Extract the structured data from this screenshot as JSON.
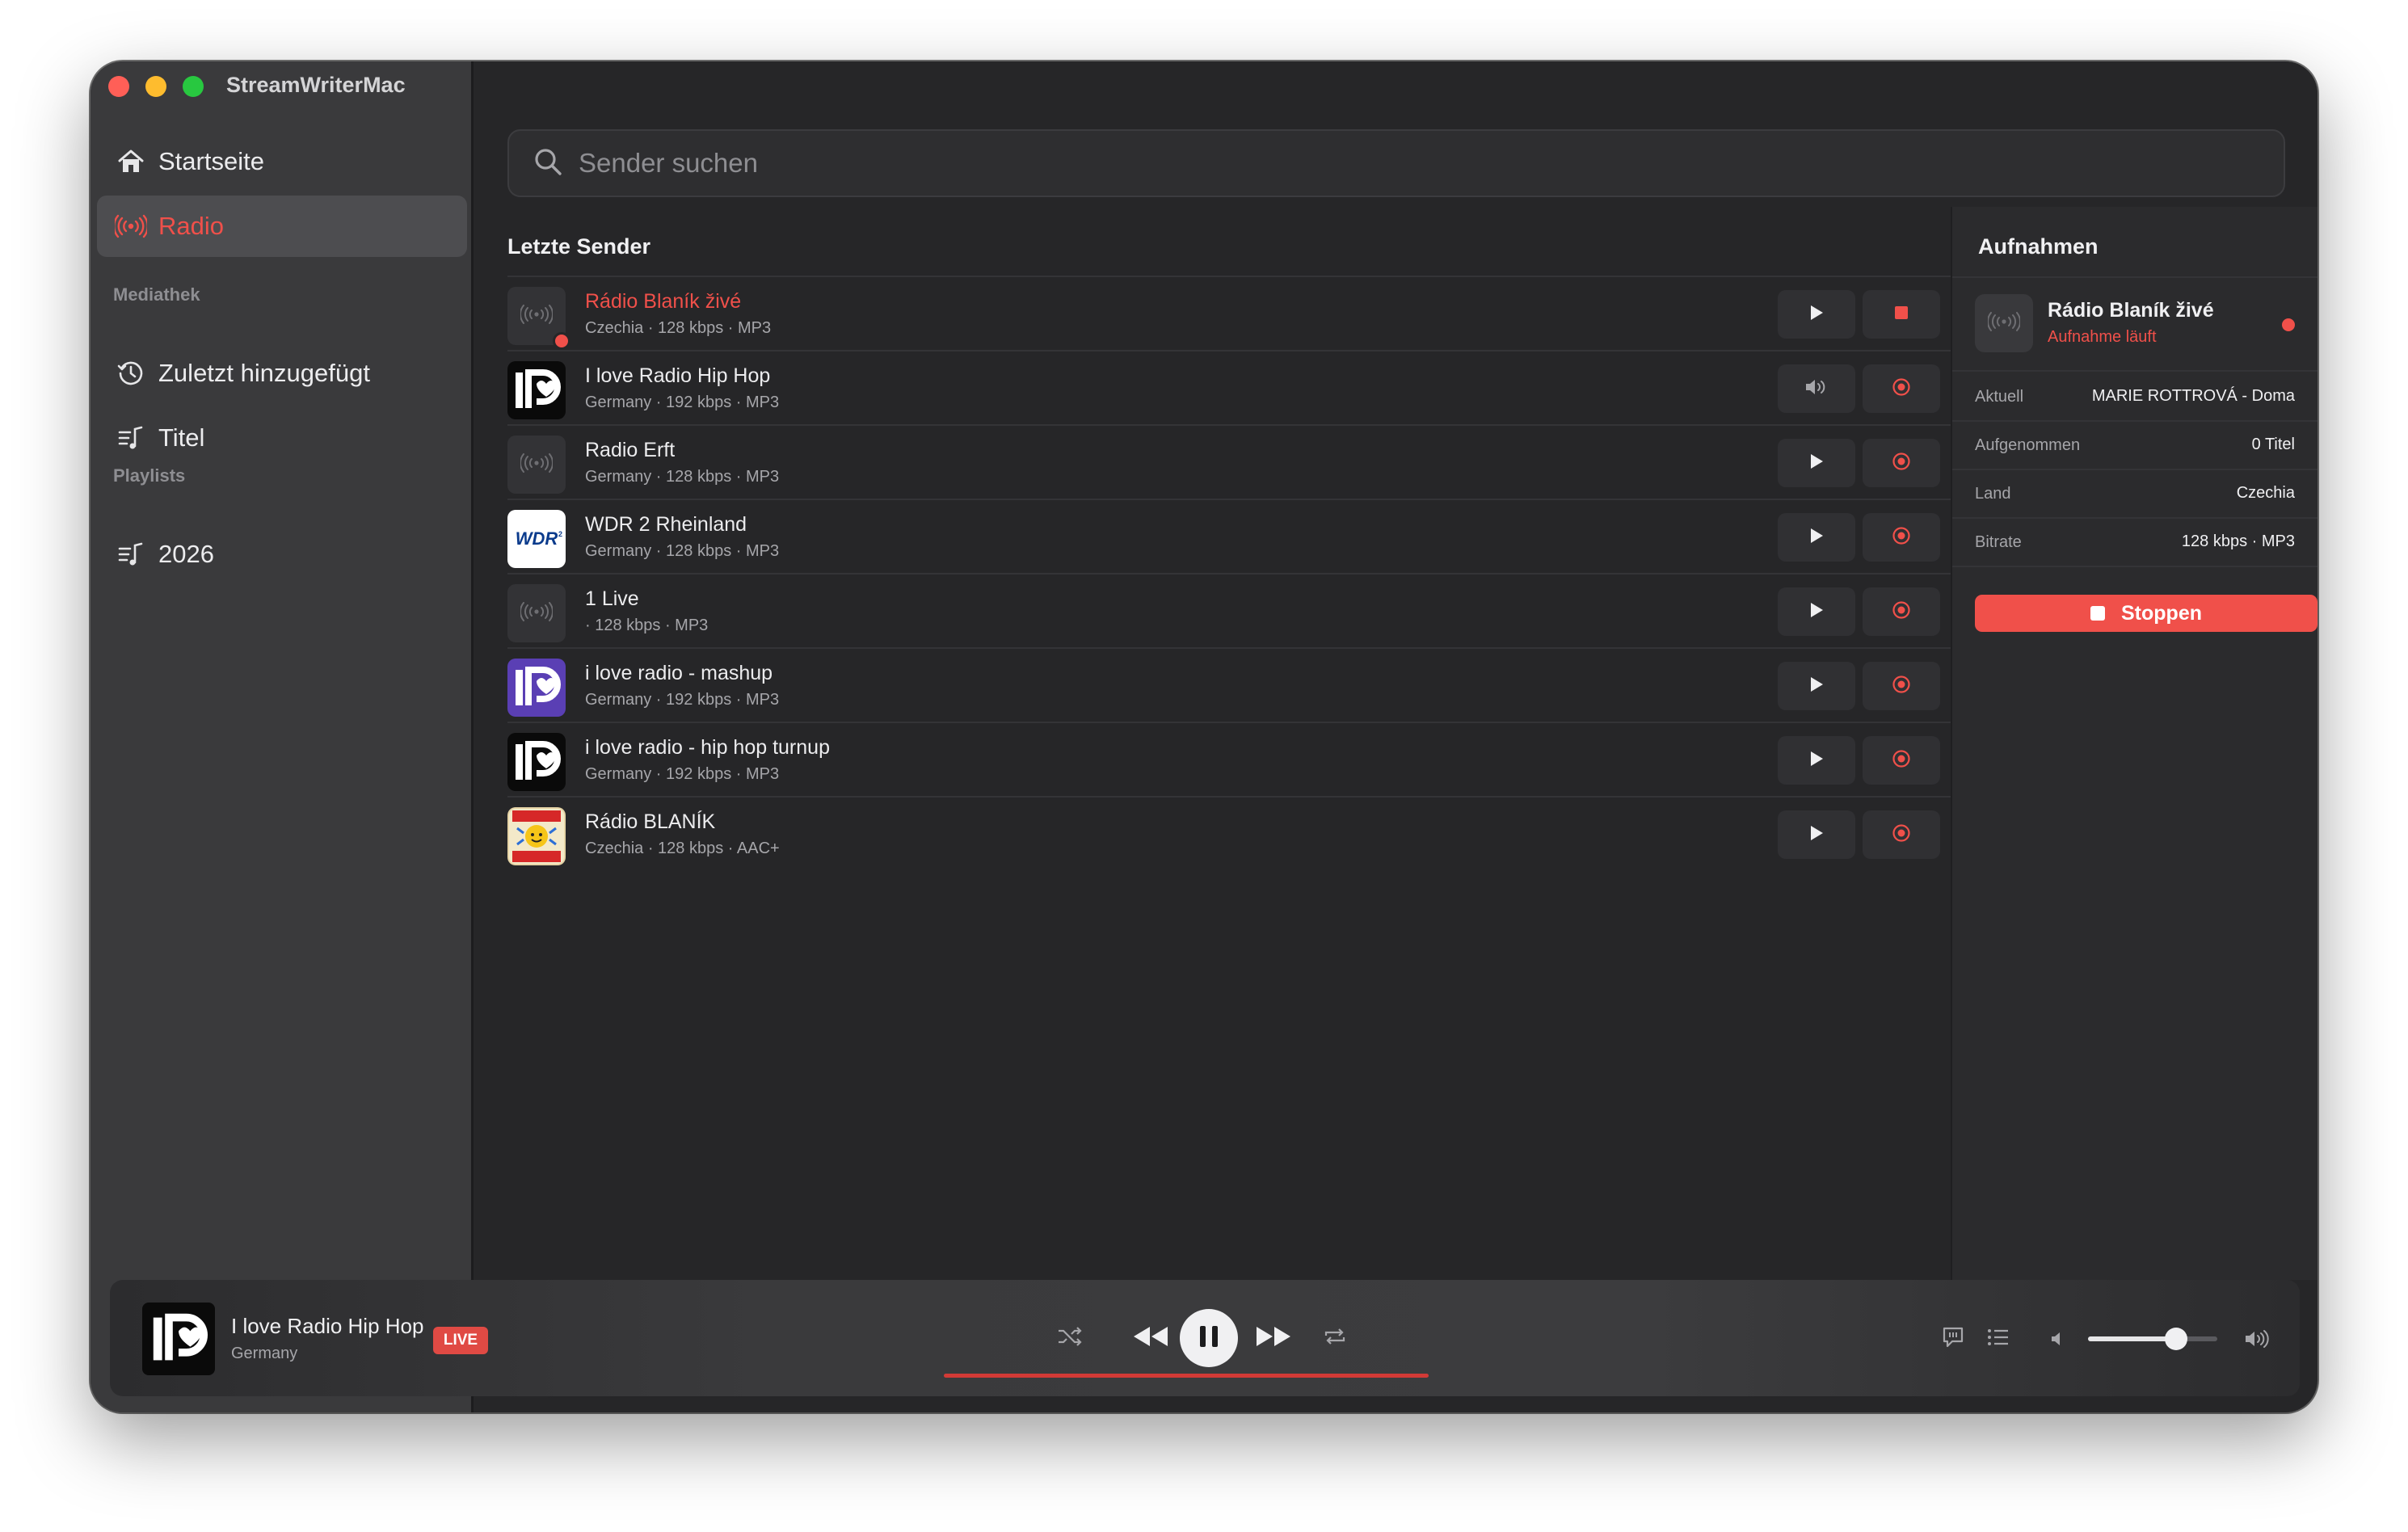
{
  "app": {
    "title": "StreamWriterMac"
  },
  "colors": {
    "accent": "#f0504a",
    "traffic_close": "#ff5f57",
    "traffic_minimize": "#febc2e",
    "traffic_zoom": "#28c840"
  },
  "sidebar": {
    "items": [
      {
        "label": "Startseite",
        "icon": "house-icon",
        "active": false
      },
      {
        "label": "Radio",
        "icon": "broadcast-icon",
        "active": true
      }
    ],
    "library_label": "Mediathek",
    "library_items": [
      {
        "label": "Zuletzt hinzugefügt",
        "icon": "clock-icon"
      },
      {
        "label": "Titel",
        "icon": "music-note-list-icon"
      }
    ],
    "playlists_label": "Playlists",
    "playlists": [
      {
        "label": "2026",
        "icon": "music-note-list-icon"
      }
    ]
  },
  "search": {
    "placeholder": "Sender suchen",
    "value": ""
  },
  "recent": {
    "title": "Letzte Sender",
    "stations": [
      {
        "name": "Rádio Blaník živé",
        "country": "Czechia",
        "bitrate": "128 kbps",
        "format": "MP3",
        "recording": true,
        "playing": false,
        "logo": "broadcast-icon"
      },
      {
        "name": "I love Radio Hip Hop",
        "country": "Germany",
        "bitrate": "192 kbps",
        "format": "MP3",
        "recording": false,
        "playing": true,
        "logo": "ilove-logo"
      },
      {
        "name": "Radio Erft",
        "country": "Germany",
        "bitrate": "128 kbps",
        "format": "MP3",
        "recording": false,
        "playing": false,
        "logo": "broadcast-icon"
      },
      {
        "name": "WDR 2 Rheinland",
        "country": "Germany",
        "bitrate": "128 kbps",
        "format": "MP3",
        "recording": false,
        "playing": false,
        "logo": "wdr-logo"
      },
      {
        "name": "1 Live",
        "country": "",
        "bitrate": "128 kbps",
        "format": "MP3",
        "recording": false,
        "playing": false,
        "logo": "broadcast-icon"
      },
      {
        "name": "i love radio - mashup",
        "country": "Germany",
        "bitrate": "192 kbps",
        "format": "MP3",
        "recording": false,
        "playing": false,
        "logo": "ilove-purple-logo"
      },
      {
        "name": "i love radio - hip hop turnup",
        "country": "Germany",
        "bitrate": "192 kbps",
        "format": "MP3",
        "recording": false,
        "playing": false,
        "logo": "ilove-logo"
      },
      {
        "name": "Rádio BLANÍK",
        "country": "Czechia",
        "bitrate": "128 kbps",
        "format": "AAC+",
        "recording": false,
        "playing": false,
        "logo": "blanik-logo"
      }
    ]
  },
  "recordings": {
    "title": "Aufnahmen",
    "active": {
      "name": "Rádio Blaník živé",
      "status": "Aufnahme läuft"
    },
    "details": [
      {
        "key": "Aktuell",
        "value": "MARIE ROTTROVÁ - Doma"
      },
      {
        "key": "Aufgenommen",
        "value": "0 Titel"
      },
      {
        "key": "Land",
        "value": "Czechia"
      },
      {
        "key": "Bitrate",
        "value": "128 kbps · MP3"
      }
    ],
    "stop_label": "Stoppen"
  },
  "player": {
    "title": "I love Radio Hip Hop",
    "subtitle": "Germany",
    "badge": "LIVE",
    "volume": 0.68,
    "state": "playing"
  }
}
